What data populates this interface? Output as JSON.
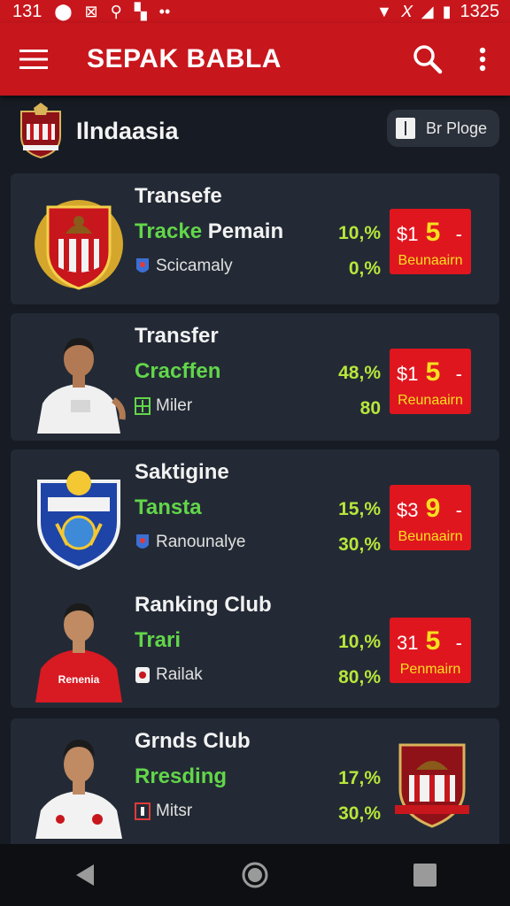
{
  "status_bar": {
    "time": "131",
    "clock": "1325"
  },
  "app_bar": {
    "title": "SEPAK BABLA"
  },
  "section": {
    "title": "Ilndaasia",
    "page_button_label": "Br Ploge"
  },
  "colors": {
    "brand_red": "#c8161d",
    "background": "#171c24",
    "card": "#232a35",
    "green": "#62d64a",
    "lime": "#b7e63b",
    "badge_red": "#e0161f",
    "yellow": "#f6e020"
  },
  "rows": [
    {
      "title": "Transefe",
      "subtitle_green": "Tracke",
      "subtitle_white": " Pemain",
      "meta": "Scicamaly",
      "meta_icon": "player-badge-icon",
      "stat1": "10,%",
      "stat2": "0,%",
      "badge": {
        "currency": "$1",
        "value": "5",
        "dash": "-",
        "label": "Beunaairn"
      },
      "avatar": "club-crest-eagle"
    },
    {
      "title": "Transfer",
      "subtitle_green": "Cracffen",
      "subtitle_white": "",
      "meta": "Miler",
      "meta_icon": "field-icon",
      "stat1": "48,%",
      "stat2": "80",
      "badge": {
        "currency": "$1",
        "value": "5",
        "dash": "-",
        "label": "Reunaairn"
      },
      "avatar": "player-photo-white-kit"
    },
    {
      "title": "Saktigine",
      "subtitle_green": "Tansta",
      "subtitle_white": "",
      "meta": "Ranounalye",
      "meta_icon": "player-badge-icon",
      "stat1": "15,%",
      "stat2": "30,%",
      "badge": {
        "currency": "$3",
        "value": "9",
        "dash": "-",
        "label": "Beunaairn"
      },
      "avatar": "club-crest-blue-shield"
    },
    {
      "title": "Ranking Club",
      "subtitle_green": "Trari",
      "subtitle_white": "",
      "meta": "Railak",
      "meta_icon": "jersey-icon",
      "stat1": "10,%",
      "stat2": "80,%",
      "badge": {
        "currency": "31",
        "value": "5",
        "dash": "-",
        "label": "Penmairn"
      },
      "avatar": "player-photo-red-kit",
      "avatar_text": "Renenia"
    },
    {
      "title": "Grnds Club",
      "subtitle_green": "Rresding",
      "subtitle_white": "",
      "meta": "Mitsr",
      "meta_icon": "goal-icon",
      "stat1": "17,%",
      "stat2": "30,%",
      "avatar": "player-photo-white-kit",
      "right_crest": "club-crest-eagle"
    }
  ]
}
